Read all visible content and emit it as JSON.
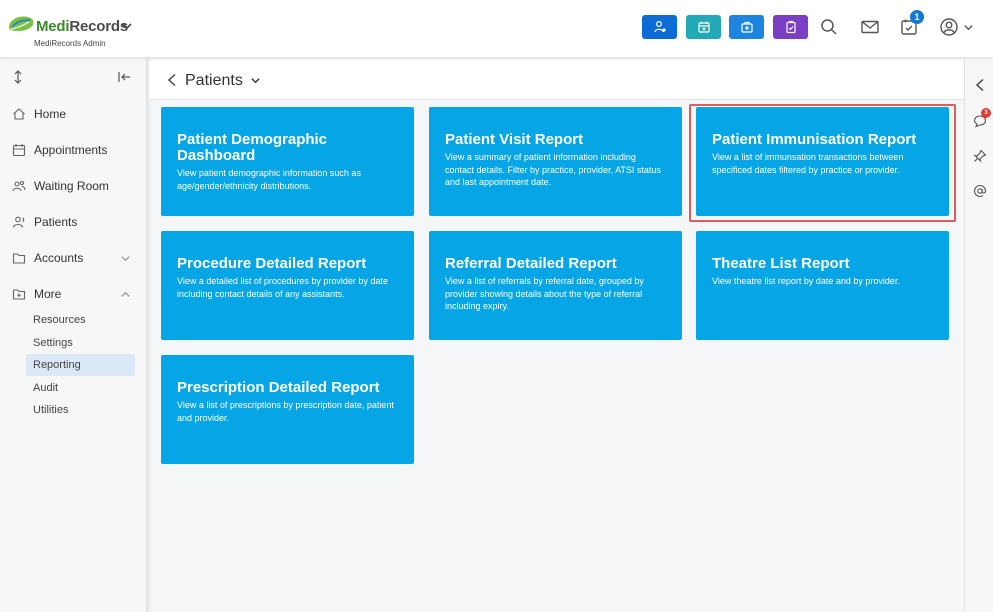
{
  "brand": {
    "name_part1": "Medi",
    "name_part2": "Records",
    "subtitle": "MediRecords Admin"
  },
  "header": {
    "quick_actions": [
      {
        "name": "add-patient",
        "icon": "person-plus-icon",
        "color": "#0d6bd6"
      },
      {
        "name": "add-appointment",
        "icon": "calendar-plus-icon",
        "color": "#21a9b5"
      },
      {
        "name": "add-encounter",
        "icon": "medical-kit-icon",
        "color": "#1d84e0"
      },
      {
        "name": "add-task",
        "icon": "clipboard-check-icon",
        "color": "#7b3fc4"
      }
    ],
    "notification_count": "1"
  },
  "sidebar": {
    "items": [
      {
        "label": "Home",
        "icon": "home-icon"
      },
      {
        "label": "Appointments",
        "icon": "calendar-icon"
      },
      {
        "label": "Waiting Room",
        "icon": "people-icon"
      },
      {
        "label": "Patients",
        "icon": "person-icon"
      },
      {
        "label": "Accounts",
        "icon": "folder-icon"
      },
      {
        "label": "More",
        "icon": "folder-plus-icon"
      }
    ],
    "sub_items": [
      {
        "label": "Resources"
      },
      {
        "label": "Settings"
      },
      {
        "label": "Reporting"
      },
      {
        "label": "Audit"
      },
      {
        "label": "Utilities"
      }
    ],
    "active_sub_item": "Reporting"
  },
  "main": {
    "title": "Patients",
    "cards": [
      {
        "title": "Patient Demographic Dashboard",
        "desc": "View patient demographic information such as age/gender/ethnicity distributions."
      },
      {
        "title": "Patient Visit Report",
        "desc": "View a summary of patient information including contact details. Filter by practice, provider, ATSI status and last appointment date."
      },
      {
        "title": "Patient Immunisation Report",
        "desc": "View a list of immunsation transactions between specificed dates filtered by practice or provider."
      },
      {
        "title": "Procedure Detailed Report",
        "desc": "View a detailed list of procedures by provider by date including contact details of any assistants."
      },
      {
        "title": "Referral Detailed Report",
        "desc": "View a list of referrals by referral date, grouped by provider showing details about the type of referral including expiry."
      },
      {
        "title": "Theatre List Report",
        "desc": "View theatre list report by date and by provider."
      },
      {
        "title": "Prescription Detailed Report",
        "desc": "View a list of prescriptions by prescription date, patient and provider."
      }
    ]
  },
  "right_rail": {
    "chat_badge": "3"
  },
  "colors": {
    "card": "#06a6e6",
    "highlight": "#e25a5a",
    "active": "#dbe9f7"
  }
}
